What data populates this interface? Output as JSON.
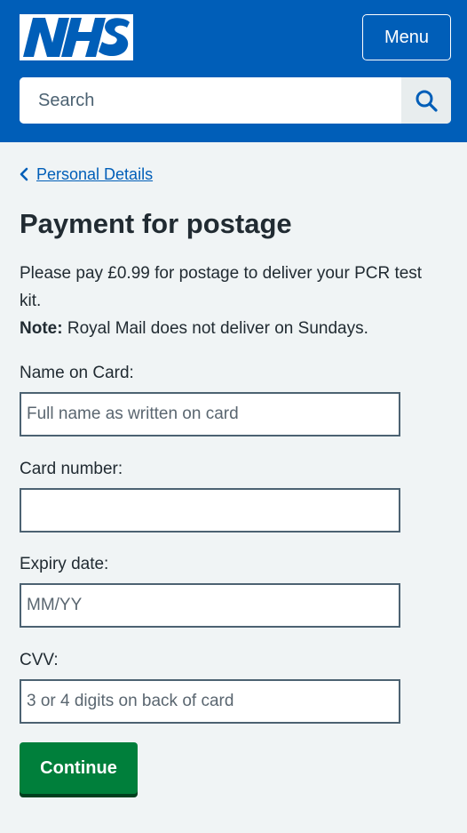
{
  "header": {
    "logo_text": "NHS",
    "menu_label": "Menu",
    "search_placeholder": "Search"
  },
  "breadcrumb": {
    "back_label": "Personal Details"
  },
  "page": {
    "title": "Payment for postage",
    "intro": "Please pay £0.99 for postage to deliver your PCR test kit.",
    "note_prefix": "Note:",
    "note_text": " Royal Mail does not deliver on Sundays."
  },
  "form": {
    "name_label": "Name on Card:",
    "name_placeholder": "Full name as written on card",
    "name_value": "",
    "card_label": "Card number:",
    "card_placeholder": "",
    "card_value": "",
    "expiry_label": "Expiry date:",
    "expiry_placeholder": "MM/YY",
    "expiry_value": "",
    "cvv_label": "CVV:",
    "cvv_placeholder": "3 or 4 digits on back of card",
    "cvv_value": "",
    "submit_label": "Continue"
  },
  "colors": {
    "brand_blue": "#005eb8",
    "button_green": "#007f3b",
    "page_bg": "#f0f4f5"
  },
  "icons": {
    "logo": "nhs-logo",
    "search": "search-icon",
    "back": "chevron-left-icon"
  }
}
